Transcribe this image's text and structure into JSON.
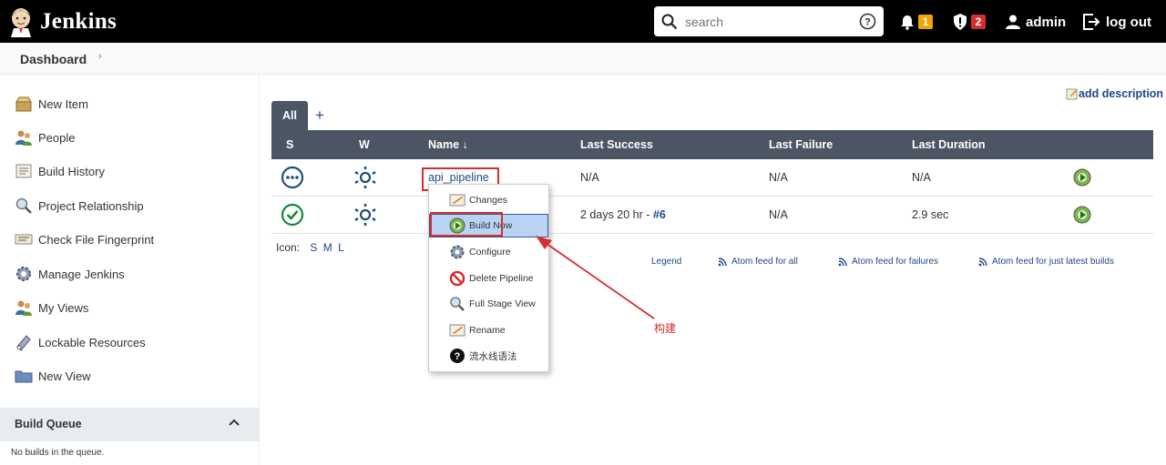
{
  "header": {
    "app_name": "Jenkins",
    "search_placeholder": "search",
    "notifications_count": "1",
    "security_count": "2",
    "user_name": "admin",
    "logout_label": "log out",
    "notification_badge_color": "#f0a500",
    "security_badge_color": "#d32f2f"
  },
  "breadcrumb": {
    "root": "Dashboard"
  },
  "sidebar": {
    "tasks": [
      {
        "label": "New Item",
        "icon": "new-item-icon"
      },
      {
        "label": "People",
        "icon": "people-icon"
      },
      {
        "label": "Build History",
        "icon": "build-history-icon"
      },
      {
        "label": "Project Relationship",
        "icon": "search-icon"
      },
      {
        "label": "Check File Fingerprint",
        "icon": "fingerprint-icon"
      },
      {
        "label": "Manage Jenkins",
        "icon": "gear-icon"
      },
      {
        "label": "My Views",
        "icon": "people-icon"
      },
      {
        "label": "Lockable Resources",
        "icon": "lock-icon"
      },
      {
        "label": "New View",
        "icon": "folder-icon"
      }
    ],
    "build_queue": {
      "title": "Build Queue",
      "empty_text": "No builds in the queue."
    }
  },
  "main": {
    "add_description": "add description",
    "tabs": {
      "all": "All",
      "add": "+"
    },
    "columns": {
      "s": "S",
      "w": "W",
      "name": "Name ↓",
      "last_success": "Last Success",
      "last_failure": "Last Failure",
      "last_duration": "Last Duration"
    },
    "jobs": [
      {
        "name": "api_pipeline",
        "last_success": "N/A",
        "last_failure": "N/A",
        "last_duration": "N/A",
        "status": "not-built"
      },
      {
        "name": "",
        "last_success": "2 days 20 hr - ",
        "build_link": "#6",
        "last_failure": "N/A",
        "last_duration": "2.9 sec",
        "status": "success"
      }
    ],
    "icon_size": {
      "label": "Icon:",
      "s": "S",
      "m": "M",
      "l": "L"
    },
    "footer_links": {
      "legend": "Legend",
      "feed_all": "Atom feed for all",
      "feed_failures": "Atom feed for failures",
      "feed_latest": "Atom feed for just latest builds"
    }
  },
  "context_menu": {
    "items": [
      {
        "label": "Changes",
        "icon": "changes-icon"
      },
      {
        "label": "Build Now",
        "icon": "build-now-icon"
      },
      {
        "label": "Configure",
        "icon": "gear-icon"
      },
      {
        "label": "Delete Pipeline",
        "icon": "delete-icon"
      },
      {
        "label": "Full Stage View",
        "icon": "search-icon"
      },
      {
        "label": "Rename",
        "icon": "rename-icon"
      },
      {
        "label": "流水线语法",
        "icon": "help-icon"
      }
    ]
  },
  "annotation": {
    "text": "构建",
    "color": "#d32f2f"
  }
}
